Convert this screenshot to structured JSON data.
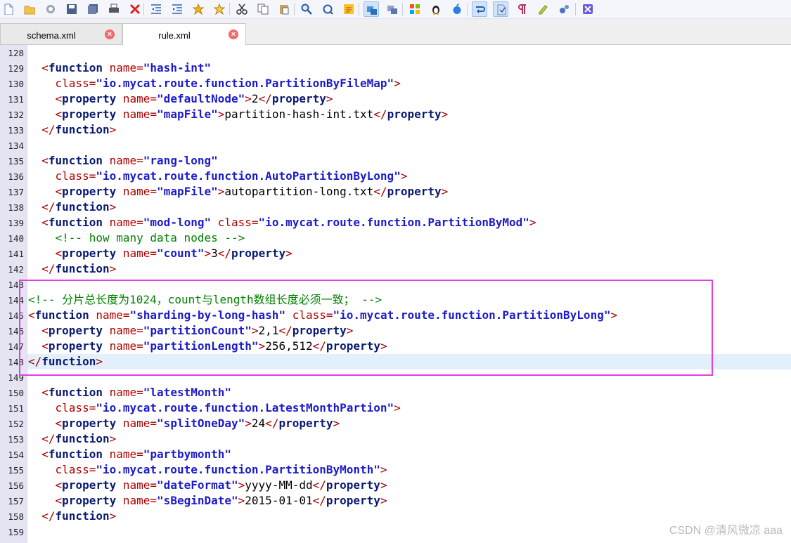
{
  "toolbar": {
    "icons": [
      "new-file",
      "open-folder",
      "reload",
      "save",
      "save-all",
      "print",
      "close",
      "outdent",
      "indent",
      "bookmark",
      "next-bookmark",
      "cut",
      "copy",
      "paste",
      "find",
      "replace",
      "highlight",
      "windows-view",
      "mac-view",
      "windows-logo",
      "linux-logo",
      "apple-logo",
      "wrap",
      "format",
      "paragraph",
      "marker",
      "settings",
      "close-window"
    ]
  },
  "tabs": [
    {
      "label": "schema.xml",
      "active": false
    },
    {
      "label": "rule.xml",
      "active": true
    }
  ],
  "editor": {
    "current_line": "148",
    "lines": [
      {
        "n": "128",
        "tokens": []
      },
      {
        "n": "129",
        "tokens": [
          [
            "tag",
            "  <"
          ],
          [
            "name",
            "function"
          ],
          [
            "attr",
            " name"
          ],
          [
            "eq",
            "="
          ],
          [
            "str",
            "\"hash-int\""
          ]
        ]
      },
      {
        "n": "130",
        "tokens": [
          [
            "attr",
            "    class"
          ],
          [
            "eq",
            "="
          ],
          [
            "str",
            "\"io.mycat.route.function.PartitionByFileMap\""
          ],
          [
            "tag",
            ">"
          ]
        ]
      },
      {
        "n": "131",
        "tokens": [
          [
            "tag",
            "    <"
          ],
          [
            "name",
            "property"
          ],
          [
            "attr",
            " name"
          ],
          [
            "eq",
            "="
          ],
          [
            "str",
            "\"defaultNode\""
          ],
          [
            "tag",
            ">"
          ],
          [
            "text",
            "2"
          ],
          [
            "tag",
            "</"
          ],
          [
            "name",
            "property"
          ],
          [
            "tag",
            ">"
          ]
        ]
      },
      {
        "n": "132",
        "tokens": [
          [
            "tag",
            "    <"
          ],
          [
            "name",
            "property"
          ],
          [
            "attr",
            " name"
          ],
          [
            "eq",
            "="
          ],
          [
            "str",
            "\"mapFile\""
          ],
          [
            "tag",
            ">"
          ],
          [
            "text",
            "partition-hash-int.txt"
          ],
          [
            "tag",
            "</"
          ],
          [
            "name",
            "property"
          ],
          [
            "tag",
            ">"
          ]
        ]
      },
      {
        "n": "133",
        "tokens": [
          [
            "tag",
            "  </"
          ],
          [
            "name",
            "function"
          ],
          [
            "tag",
            ">"
          ]
        ]
      },
      {
        "n": "134",
        "tokens": []
      },
      {
        "n": "135",
        "tokens": [
          [
            "tag",
            "  <"
          ],
          [
            "name",
            "function"
          ],
          [
            "attr",
            " name"
          ],
          [
            "eq",
            "="
          ],
          [
            "str",
            "\"rang-long\""
          ]
        ]
      },
      {
        "n": "136",
        "tokens": [
          [
            "attr",
            "    class"
          ],
          [
            "eq",
            "="
          ],
          [
            "str",
            "\"io.mycat.route.function.AutoPartitionByLong\""
          ],
          [
            "tag",
            ">"
          ]
        ]
      },
      {
        "n": "137",
        "tokens": [
          [
            "tag",
            "    <"
          ],
          [
            "name",
            "property"
          ],
          [
            "attr",
            " name"
          ],
          [
            "eq",
            "="
          ],
          [
            "str",
            "\"mapFile\""
          ],
          [
            "tag",
            ">"
          ],
          [
            "text",
            "autopartition-long.txt"
          ],
          [
            "tag",
            "</"
          ],
          [
            "name",
            "property"
          ],
          [
            "tag",
            ">"
          ]
        ]
      },
      {
        "n": "138",
        "tokens": [
          [
            "tag",
            "  </"
          ],
          [
            "name",
            "function"
          ],
          [
            "tag",
            ">"
          ]
        ]
      },
      {
        "n": "139",
        "tokens": [
          [
            "tag",
            "  <"
          ],
          [
            "name",
            "function"
          ],
          [
            "attr",
            " name"
          ],
          [
            "eq",
            "="
          ],
          [
            "str",
            "\"mod-long\""
          ],
          [
            "attr",
            " class"
          ],
          [
            "eq",
            "="
          ],
          [
            "str",
            "\"io.mycat.route.function.PartitionByMod\""
          ],
          [
            "tag",
            ">"
          ]
        ]
      },
      {
        "n": "140",
        "tokens": [
          [
            "com",
            "    <!-- how many data nodes -->"
          ]
        ]
      },
      {
        "n": "141",
        "tokens": [
          [
            "tag",
            "    <"
          ],
          [
            "name",
            "property"
          ],
          [
            "attr",
            " name"
          ],
          [
            "eq",
            "="
          ],
          [
            "str",
            "\"count\""
          ],
          [
            "tag",
            ">"
          ],
          [
            "text",
            "3"
          ],
          [
            "tag",
            "</"
          ],
          [
            "name",
            "property"
          ],
          [
            "tag",
            ">"
          ]
        ]
      },
      {
        "n": "142",
        "tokens": [
          [
            "tag",
            "  </"
          ],
          [
            "name",
            "function"
          ],
          [
            "tag",
            ">"
          ]
        ]
      },
      {
        "n": "143",
        "tokens": []
      },
      {
        "n": "144",
        "tokens": [
          [
            "com",
            "<!-- 分片总长度为1024，count与length数组长度必须一致； -->"
          ]
        ]
      },
      {
        "n": "145",
        "tokens": [
          [
            "tag",
            "<"
          ],
          [
            "name",
            "function"
          ],
          [
            "attr",
            " name"
          ],
          [
            "eq",
            "="
          ],
          [
            "str",
            "\"sharding-by-long-hash\""
          ],
          [
            "attr",
            " class"
          ],
          [
            "eq",
            "="
          ],
          [
            "str",
            "\"io.mycat.route.function.PartitionByLong\""
          ],
          [
            "tag",
            ">"
          ]
        ]
      },
      {
        "n": "146",
        "tokens": [
          [
            "tag",
            "  <"
          ],
          [
            "name",
            "property"
          ],
          [
            "attr",
            " name"
          ],
          [
            "eq",
            "="
          ],
          [
            "str",
            "\"partitionCount\""
          ],
          [
            "tag",
            ">"
          ],
          [
            "text",
            "2,1"
          ],
          [
            "tag",
            "</"
          ],
          [
            "name",
            "property"
          ],
          [
            "tag",
            ">"
          ]
        ]
      },
      {
        "n": "147",
        "tokens": [
          [
            "tag",
            "  <"
          ],
          [
            "name",
            "property"
          ],
          [
            "attr",
            " name"
          ],
          [
            "eq",
            "="
          ],
          [
            "str",
            "\"partitionLength\""
          ],
          [
            "tag",
            ">"
          ],
          [
            "text",
            "256,512"
          ],
          [
            "tag",
            "</"
          ],
          [
            "name",
            "property"
          ],
          [
            "tag",
            ">"
          ]
        ]
      },
      {
        "n": "148",
        "tokens": [
          [
            "tag",
            "</"
          ],
          [
            "name",
            "function"
          ],
          [
            "tag",
            ">"
          ]
        ]
      },
      {
        "n": "149",
        "tokens": []
      },
      {
        "n": "150",
        "tokens": [
          [
            "tag",
            "  <"
          ],
          [
            "name",
            "function"
          ],
          [
            "attr",
            " name"
          ],
          [
            "eq",
            "="
          ],
          [
            "str",
            "\"latestMonth\""
          ]
        ]
      },
      {
        "n": "151",
        "tokens": [
          [
            "attr",
            "    class"
          ],
          [
            "eq",
            "="
          ],
          [
            "str",
            "\"io.mycat.route.function.LatestMonthPartion\""
          ],
          [
            "tag",
            ">"
          ]
        ]
      },
      {
        "n": "152",
        "tokens": [
          [
            "tag",
            "    <"
          ],
          [
            "name",
            "property"
          ],
          [
            "attr",
            " name"
          ],
          [
            "eq",
            "="
          ],
          [
            "str",
            "\"splitOneDay\""
          ],
          [
            "tag",
            ">"
          ],
          [
            "text",
            "24"
          ],
          [
            "tag",
            "</"
          ],
          [
            "name",
            "property"
          ],
          [
            "tag",
            ">"
          ]
        ]
      },
      {
        "n": "153",
        "tokens": [
          [
            "tag",
            "  </"
          ],
          [
            "name",
            "function"
          ],
          [
            "tag",
            ">"
          ]
        ]
      },
      {
        "n": "154",
        "tokens": [
          [
            "tag",
            "  <"
          ],
          [
            "name",
            "function"
          ],
          [
            "attr",
            " name"
          ],
          [
            "eq",
            "="
          ],
          [
            "str",
            "\"partbymonth\""
          ]
        ]
      },
      {
        "n": "155",
        "tokens": [
          [
            "attr",
            "    class"
          ],
          [
            "eq",
            "="
          ],
          [
            "str",
            "\"io.mycat.route.function.PartitionByMonth\""
          ],
          [
            "tag",
            ">"
          ]
        ]
      },
      {
        "n": "156",
        "tokens": [
          [
            "tag",
            "    <"
          ],
          [
            "name",
            "property"
          ],
          [
            "attr",
            " name"
          ],
          [
            "eq",
            "="
          ],
          [
            "str",
            "\"dateFormat\""
          ],
          [
            "tag",
            ">"
          ],
          [
            "text",
            "yyyy-MM-dd"
          ],
          [
            "tag",
            "</"
          ],
          [
            "name",
            "property"
          ],
          [
            "tag",
            ">"
          ]
        ]
      },
      {
        "n": "157",
        "tokens": [
          [
            "tag",
            "    <"
          ],
          [
            "name",
            "property"
          ],
          [
            "attr",
            " name"
          ],
          [
            "eq",
            "="
          ],
          [
            "str",
            "\"sBeginDate\""
          ],
          [
            "tag",
            ">"
          ],
          [
            "text",
            "2015-01-01"
          ],
          [
            "tag",
            "</"
          ],
          [
            "name",
            "property"
          ],
          [
            "tag",
            ">"
          ]
        ]
      },
      {
        "n": "158",
        "tokens": [
          [
            "tag",
            "  </"
          ],
          [
            "name",
            "function"
          ],
          [
            "tag",
            ">"
          ]
        ]
      },
      {
        "n": "159",
        "tokens": []
      }
    ]
  },
  "watermark": "CSDN @清风微凉 aaa"
}
